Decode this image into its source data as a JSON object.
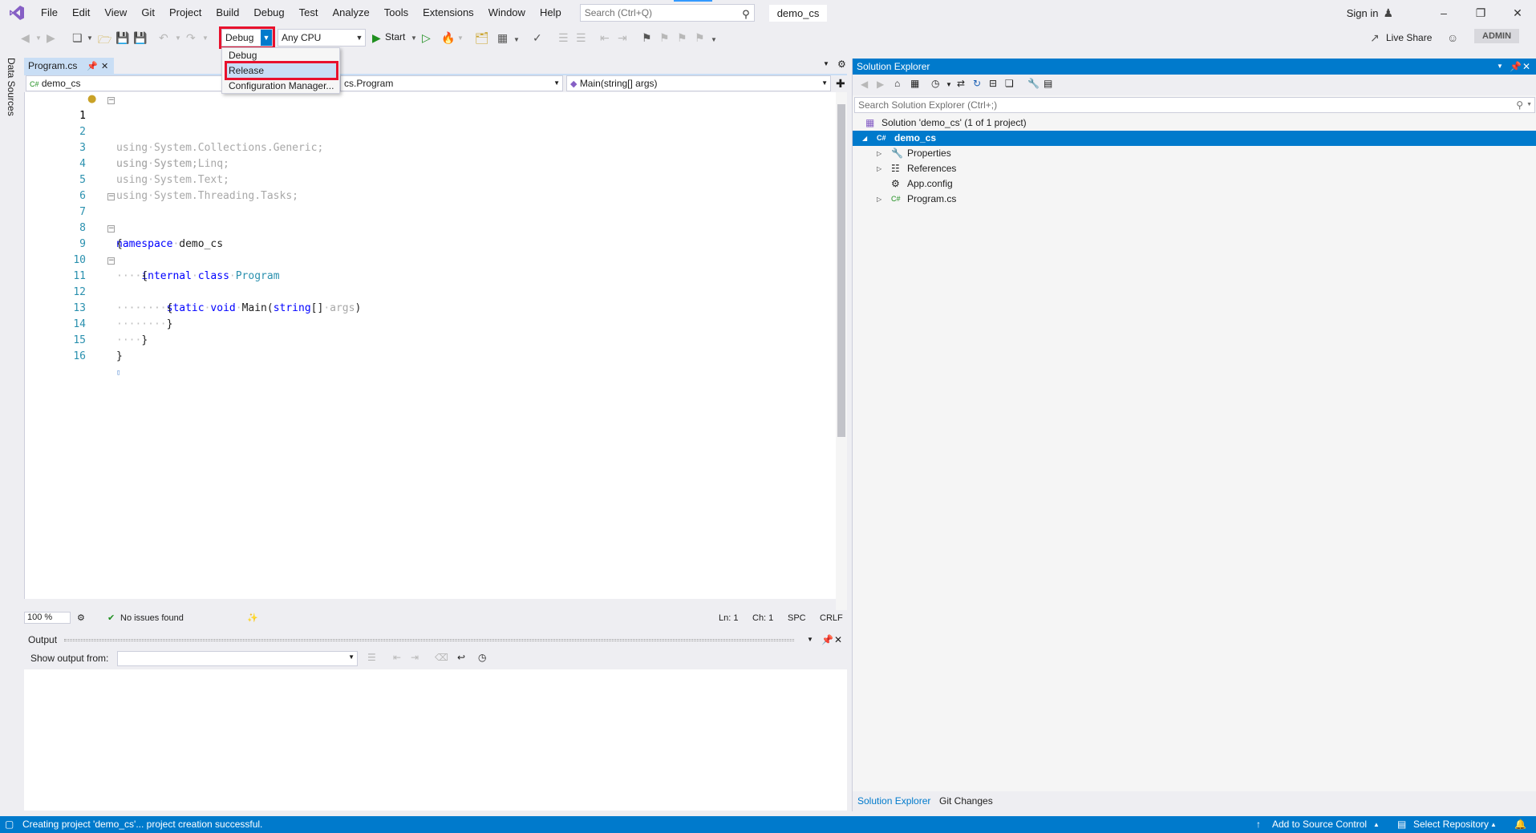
{
  "menubar": {
    "items": [
      "File",
      "Edit",
      "View",
      "Git",
      "Project",
      "Build",
      "Debug",
      "Test",
      "Analyze",
      "Tools",
      "Extensions",
      "Window",
      "Help"
    ],
    "search_placeholder": "Search (Ctrl+Q)",
    "solution_name": "demo_cs",
    "sign_in": "Sign in"
  },
  "toolbar": {
    "config_value": "Debug",
    "platform_value": "Any CPU",
    "start_label": "Start",
    "live_share": "Live Share",
    "admin": "ADMIN"
  },
  "config_dropdown": {
    "items": [
      "Debug",
      "Release",
      "Configuration Manager..."
    ],
    "highlighted": "Release"
  },
  "left_strip": {
    "label": "Data Sources"
  },
  "editor": {
    "tab_label": "Program.cs",
    "nav": {
      "project": "demo_cs",
      "class": "cs.Program",
      "member": "Main(string[] args)"
    },
    "lines": [
      "1",
      "2",
      "3",
      "4",
      "5",
      "6",
      "7",
      "8",
      "9",
      "10",
      "11",
      "12",
      "13",
      "14",
      "15",
      "16"
    ],
    "code": {
      "l1_kw": "using",
      "l1_rest": "System;",
      "l2_kw": "using",
      "l2_rest": "System.Collections.Generic;",
      "l3_kw": "using",
      "l3_rest": "System.Linq;",
      "l4_kw": "using",
      "l4_rest": "System.Text;",
      "l5_kw": "using",
      "l5_rest": "System.Threading.Tasks;",
      "l7_kw": "namespace",
      "l7_rest": "demo_cs",
      "l8": "{",
      "l9_kw1": "internal",
      "l9_kw2": "class",
      "l9_type": "Program",
      "l10": "{",
      "l11_kw1": "static",
      "l11_kw2": "void",
      "l11_name": "Main(",
      "l11_kw3": "string",
      "l11_br": "[]",
      "l11_arg": "args",
      "l11_close": ")",
      "l12": "{",
      "l13": "}",
      "l14": "}",
      "l15": "}"
    },
    "status": {
      "zoom": "100 %",
      "issues": "No issues found",
      "ln": "Ln: 1",
      "ch": "Ch: 1",
      "spc": "SPC",
      "crlf": "CRLF"
    }
  },
  "output": {
    "title": "Output",
    "show_from_label": "Show output from:",
    "show_from_value": ""
  },
  "solution_explorer": {
    "title": "Solution Explorer",
    "search_placeholder": "Search Solution Explorer (Ctrl+;)",
    "tree": {
      "solution": "Solution 'demo_cs' (1 of 1 project)",
      "project": "demo_cs",
      "properties": "Properties",
      "references": "References",
      "app_config": "App.config",
      "program_cs": "Program.cs"
    },
    "bottom_tabs": [
      "Solution Explorer",
      "Git Changes"
    ]
  },
  "statusbar": {
    "message": "Creating project 'demo_cs'... project creation successful.",
    "add_source_control": "Add to Source Control",
    "select_repository": "Select Repository"
  },
  "colors": {
    "accent": "#007acc",
    "highlight_red": "#e8112d",
    "keyword": "#0000ff",
    "type": "#2b91af"
  }
}
